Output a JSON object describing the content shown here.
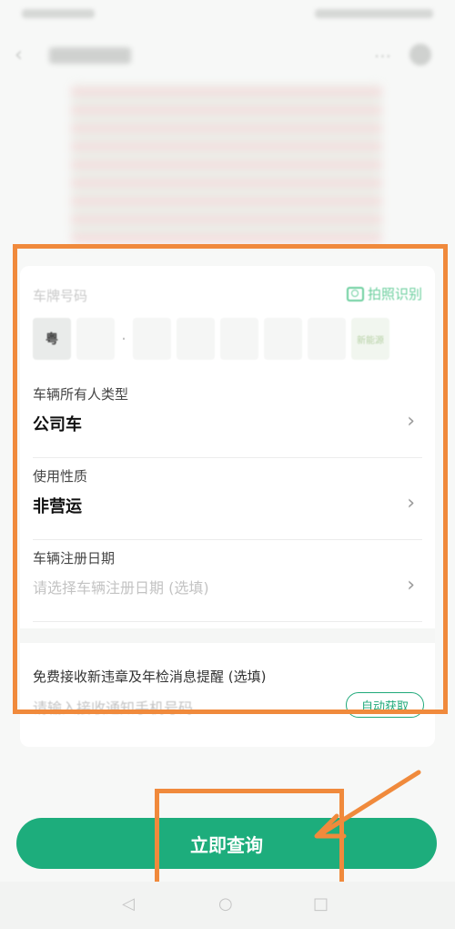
{
  "form": {
    "plate_label": "车牌号码",
    "scan_label": "拍照识别",
    "plate_province": "粤",
    "plate_new_energy": "新能源",
    "owner_type_label": "车辆所有人类型",
    "owner_type_value": "公司车",
    "usage_label": "使用性质",
    "usage_value": "非营运",
    "reg_date_label": "车辆注册日期",
    "reg_date_placeholder": "请选择车辆注册日期 (选填)",
    "notify_label": "免费接收新违章及年检消息提醒 (选填)",
    "notify_placeholder": "请输入接收通知手机号码",
    "auto_fill": "自动获取"
  },
  "submit_label": "立即查询",
  "accent": "#1dad7c",
  "highlight_color": "#f08a3c"
}
